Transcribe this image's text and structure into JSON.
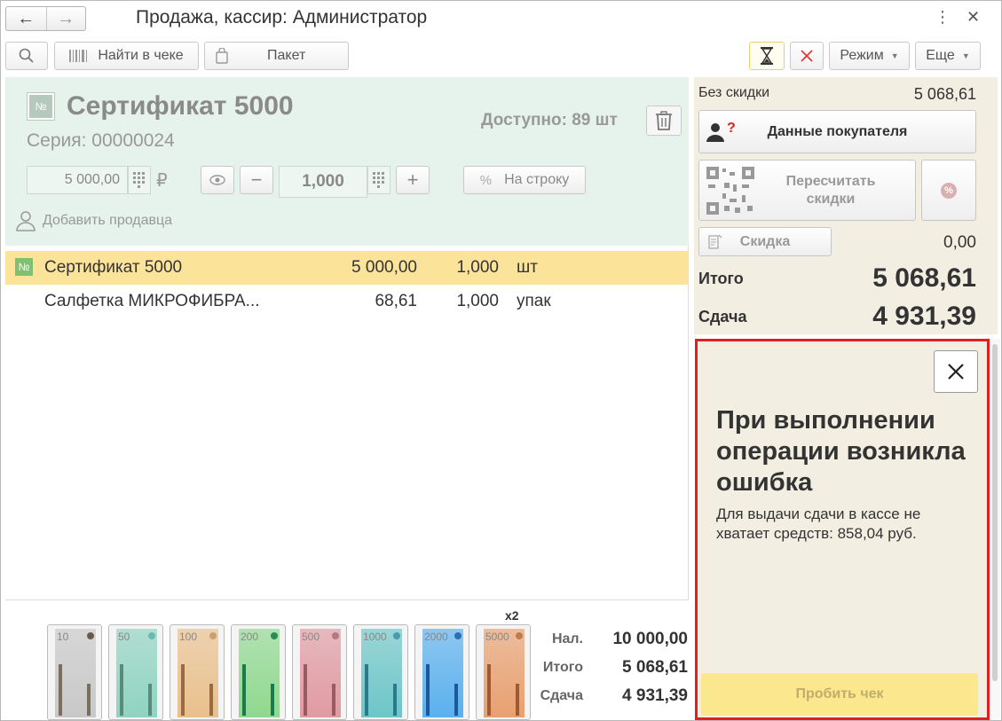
{
  "window": {
    "title": "Продажа, кассир: Администратор",
    "back_icon": "←",
    "forward_icon": "→",
    "menu_icon": "⋮",
    "close_icon": "✕"
  },
  "toolbar": {
    "find_in_receipt": "Найти в чеке",
    "package": "Пакет",
    "mode": "Режим",
    "more": "Еще"
  },
  "product": {
    "badge": "№",
    "name": "Сертификат 5000",
    "series": "Серия: 00000024",
    "available": "Доступно: 89 шт",
    "price": "5 000,00",
    "currency": "₽",
    "quantity": "1,000",
    "per_line": "На строку",
    "add_seller": "Добавить продавца"
  },
  "items": [
    {
      "badge": "№",
      "name": "Сертификат 5000",
      "amount": "5 000,00",
      "qty": "1,000",
      "unit": "шт"
    },
    {
      "badge": "",
      "name": "Салфетка МИКРОФИБРА...",
      "amount": "68,61",
      "qty": "1,000",
      "unit": "упак"
    }
  ],
  "bills": [
    {
      "den": "10",
      "color": "#c8c8c8",
      "dot": "#6b5a4a",
      "stripe": "#7a6e60"
    },
    {
      "den": "50",
      "color": "#8fd3c0",
      "dot": "#6ab9b9",
      "stripe": "#5a8a7a"
    },
    {
      "den": "100",
      "color": "#e9c08c",
      "dot": "#c9a070",
      "stripe": "#9a6a40"
    },
    {
      "den": "200",
      "color": "#8fd88f",
      "dot": "#2a8a5a",
      "stripe": "#1a7a4a"
    },
    {
      "den": "500",
      "color": "#e09aa2",
      "dot": "#b07a80",
      "stripe": "#9a5a60"
    },
    {
      "den": "1000",
      "color": "#6cc6c8",
      "dot": "#4a9ab0",
      "stripe": "#2a7a8a"
    },
    {
      "den": "2000",
      "color": "#5ab0ee",
      "dot": "#2a70b0",
      "stripe": "#1a5a9a"
    },
    {
      "den": "5000",
      "color": "#e8a070",
      "dot": "#c07a50",
      "stripe": "#a05a30"
    }
  ],
  "bill_multiplier": "x2",
  "cash_summary": {
    "cash_label": "Нал.",
    "cash_value": "10 000,00",
    "total_label": "Итого",
    "total_value": "5 068,61",
    "change_label": "Сдача",
    "change_value": "4 931,39"
  },
  "right_panel": {
    "no_discount_label": "Без скидки",
    "no_discount_value": "5 068,61",
    "customer_data": "Данные покупателя",
    "recalc_discounts": "Пересчитать скидки",
    "discount": "Скидка",
    "discount_value": "0,00",
    "total_label": "Итого",
    "total_value": "5 068,61",
    "change_label": "Сдача",
    "change_value": "4 931,39"
  },
  "error": {
    "title": "При выполнении операции возникла ошибка",
    "message": "Для выдачи сдачи в кассе не хватает средств: 858,04 руб.",
    "print_receipt": "Пробить чек"
  },
  "colors": {
    "selected_row": "#fbe39a",
    "product_panel": "#e6f3ec",
    "right_panel": "#f2eee2",
    "error_border": "#e02020"
  }
}
